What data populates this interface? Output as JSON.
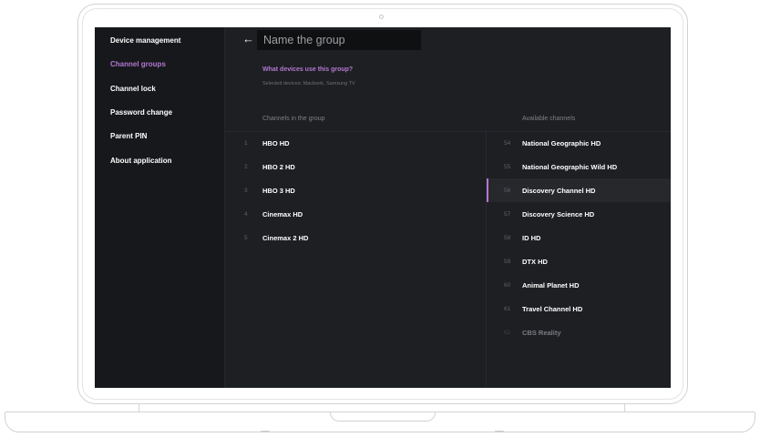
{
  "sidebar": {
    "items": [
      {
        "label": "Device management",
        "active": false
      },
      {
        "label": "Channel groups",
        "active": true
      },
      {
        "label": "Channel lock",
        "active": false
      },
      {
        "label": "Password change",
        "active": false
      },
      {
        "label": "Parent PIN",
        "active": false
      },
      {
        "label": "About application",
        "active": false
      }
    ]
  },
  "header": {
    "back_icon": "arrow-left-icon",
    "group_name_placeholder": "Name the group"
  },
  "devices": {
    "question": "What devices use this group?",
    "selected": "Selected devices: Macbook, Samsung TV"
  },
  "group_channels": {
    "heading": "Channels in the group",
    "items": [
      {
        "num": "1",
        "name": "HBO HD"
      },
      {
        "num": "2",
        "name": "HBO 2 HD"
      },
      {
        "num": "3",
        "name": "HBO 3 HD"
      },
      {
        "num": "4",
        "name": "Cinemax HD"
      },
      {
        "num": "5",
        "name": "Cinemax 2 HD"
      }
    ]
  },
  "available_channels": {
    "heading": "Available channels",
    "items": [
      {
        "num": "54",
        "name": "National Geographic HD"
      },
      {
        "num": "55",
        "name": "National Geographic Wild HD"
      },
      {
        "num": "56",
        "name": "Discovery Channel HD",
        "selected": true
      },
      {
        "num": "57",
        "name": "Discovery Science HD"
      },
      {
        "num": "58",
        "name": "ID HD"
      },
      {
        "num": "59",
        "name": "DTX HD"
      },
      {
        "num": "60",
        "name": "Animal Planet HD"
      },
      {
        "num": "61",
        "name": "Travel Channel HD"
      },
      {
        "num": "62",
        "name": "CBS Reality",
        "faded": true
      }
    ]
  },
  "colors": {
    "accent": "#b477d1",
    "background": "#16181b",
    "panel": "#1d1f22"
  }
}
